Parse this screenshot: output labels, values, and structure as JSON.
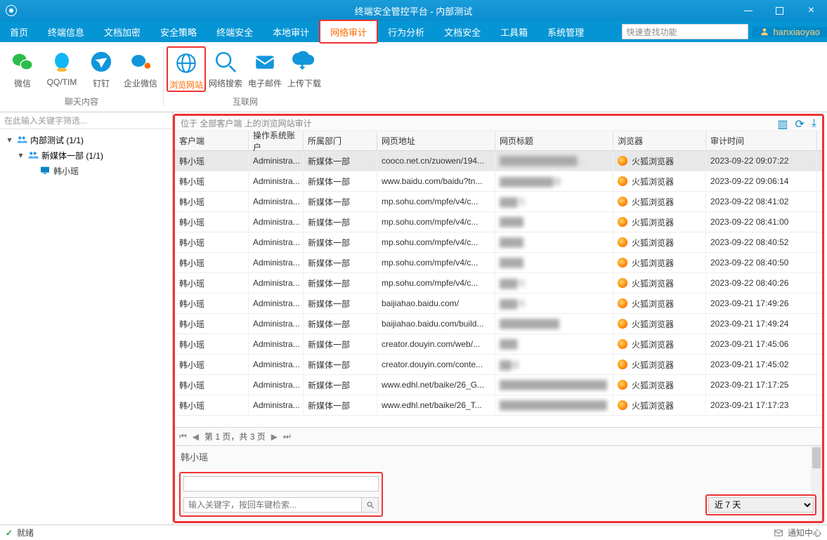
{
  "window": {
    "title": "终端安全管控平台 - 内部测试"
  },
  "menu": {
    "items": [
      "首页",
      "终端信息",
      "文档加密",
      "安全策略",
      "终端安全",
      "本地审计",
      "网络审计",
      "行为分析",
      "文档安全",
      "工具箱",
      "系统管理"
    ],
    "active_index": 6,
    "search_placeholder": "快速查找功能",
    "user": "hanxiaoyao"
  },
  "ribbon": {
    "groups": [
      {
        "label": "聊天内容",
        "items": [
          {
            "label": "微信",
            "icon": "wechat-icon"
          },
          {
            "label": "QQ/TIM",
            "icon": "qq-icon"
          },
          {
            "label": "钉钉",
            "icon": "dingtalk-icon"
          },
          {
            "label": "企业微信",
            "icon": "wecom-icon"
          }
        ]
      },
      {
        "label": "互联网",
        "items": [
          {
            "label": "浏览网站",
            "icon": "globe-icon",
            "active": true
          },
          {
            "label": "网络搜索",
            "icon": "search-net-icon"
          },
          {
            "label": "电子邮件",
            "icon": "mail-icon"
          },
          {
            "label": "上传下载",
            "icon": "updown-icon"
          }
        ]
      }
    ]
  },
  "sidebar": {
    "filter_placeholder": "在此输入关键字筛选...",
    "tree": {
      "root": {
        "label": "内部测试 (1/1)"
      },
      "child": {
        "label": "新媒体一部 (1/1)"
      },
      "leaf": {
        "label": "韩小瑶"
      }
    }
  },
  "crumb": "位于 全部客户端 上的浏览网站审计",
  "columns": {
    "client": "客户端",
    "acct": "操作系统账户",
    "dept": "所属部门",
    "url": "网页地址",
    "title": "网页标题",
    "browser": "浏览器",
    "time": "审计时间"
  },
  "browser_label": "火狐浏览器",
  "rows": [
    {
      "client": "韩小瑶",
      "acct": "Administra...",
      "dept": "新媒体一部",
      "url": "cooco.net.cn/zuowen/194...",
      "title": "█████████████:...",
      "time": "2023-09-22 09:07:22",
      "sel": true
    },
    {
      "client": "韩小瑶",
      "acct": "Administra...",
      "dept": "新媒体一部",
      "url": "www.baidu.com/baidu?tn...",
      "title": "█████████案",
      "time": "2023-09-22 09:06:14"
    },
    {
      "client": "韩小瑶",
      "acct": "Administra...",
      "dept": "新媒体一部",
      "url": "mp.sohu.com/mpfe/v4/c...",
      "title": "███号",
      "time": "2023-09-22 08:41:02"
    },
    {
      "client": "韩小瑶",
      "acct": "Administra...",
      "dept": "新媒体一部",
      "url": "mp.sohu.com/mpfe/v4/c...",
      "title": "████",
      "time": "2023-09-22 08:41:00"
    },
    {
      "client": "韩小瑶",
      "acct": "Administra...",
      "dept": "新媒体一部",
      "url": "mp.sohu.com/mpfe/v4/c...",
      "title": "████",
      "time": "2023-09-22 08:40:52"
    },
    {
      "client": "韩小瑶",
      "acct": "Administra...",
      "dept": "新媒体一部",
      "url": "mp.sohu.com/mpfe/v4/c...",
      "title": "████",
      "time": "2023-09-22 08:40:50"
    },
    {
      "client": "韩小瑶",
      "acct": "Administra...",
      "dept": "新媒体一部",
      "url": "mp.sohu.com/mpfe/v4/c...",
      "title": "███号",
      "time": "2023-09-22 08:40:26"
    },
    {
      "client": "韩小瑶",
      "acct": "Administra...",
      "dept": "新媒体一部",
      "url": "baijiahao.baidu.com/",
      "title": "███号",
      "time": "2023-09-21 17:49:26"
    },
    {
      "client": "韩小瑶",
      "acct": "Administra...",
      "dept": "新媒体一部",
      "url": "baijiahao.baidu.com/build...",
      "title": "██████████",
      "time": "2023-09-21 17:49:24"
    },
    {
      "client": "韩小瑶",
      "acct": "Administra...",
      "dept": "新媒体一部",
      "url": "creator.douyin.com/web/...",
      "title": "███",
      "time": "2023-09-21 17:45:06"
    },
    {
      "client": "韩小瑶",
      "acct": "Administra...",
      "dept": "新媒体一部",
      "url": "creator.douyin.com/conte...",
      "title": "██者",
      "time": "2023-09-21 17:45:02"
    },
    {
      "client": "韩小瑶",
      "acct": "Administra...",
      "dept": "新媒体一部",
      "url": "www.edhl.net/baike/26_G...",
      "title": "██████████████████",
      "time": "2023-09-21 17:17:25"
    },
    {
      "client": "韩小瑶",
      "acct": "Administra...",
      "dept": "新媒体一部",
      "url": "www.edhl.net/baike/26_T...",
      "title": "██████████████████",
      "time": "2023-09-21 17:17:23"
    }
  ],
  "pager": {
    "text": "第 1 页，共 3 页"
  },
  "detail": {
    "name": "韩小瑶",
    "search_placeholder": "输入关键字，按回车键检索...",
    "period": "近 7 天"
  },
  "status": {
    "ready": "就绪",
    "notify": "通知中心"
  }
}
